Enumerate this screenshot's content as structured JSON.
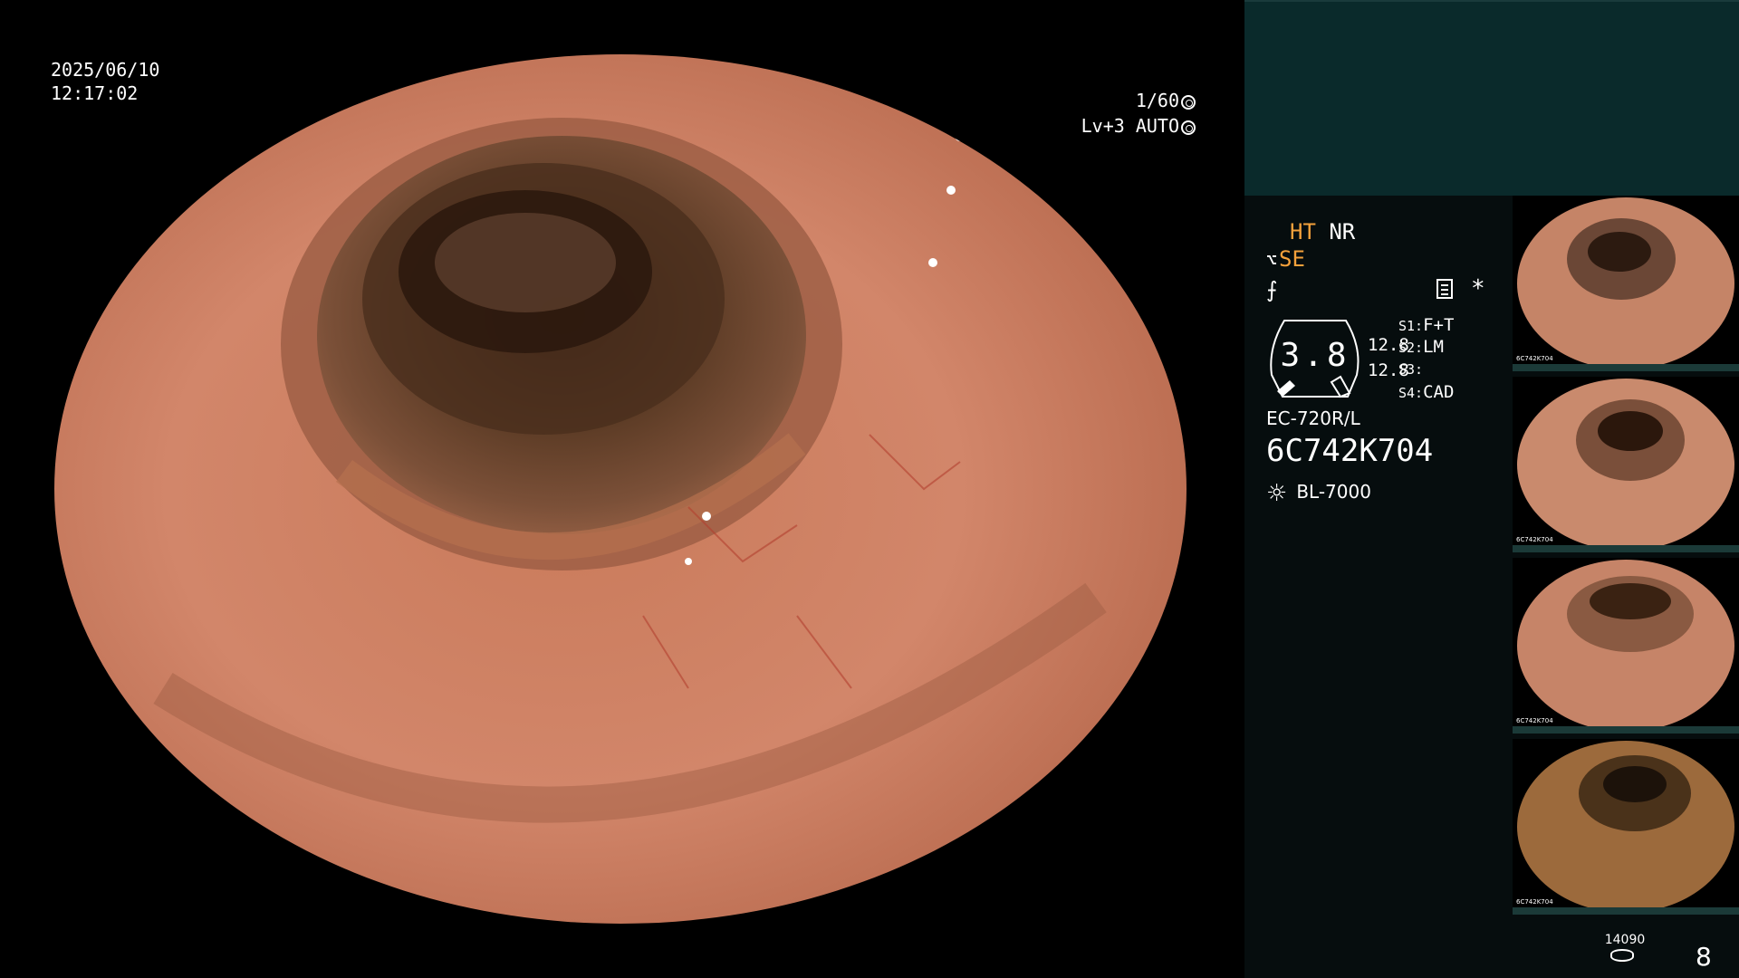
{
  "overlay": {
    "date": "2025/06/10",
    "time": "12:17:02",
    "shutter": "1/60",
    "brightness": "Lv+3 AUTO"
  },
  "status": {
    "ht": "HT",
    "nr": "NR",
    "se": "SE",
    "gauge_value": "3.8",
    "gauge_sub1": "12.8",
    "gauge_sub2": "12.8",
    "s1_key": "S1:",
    "s1_val": "F+T",
    "s2_key": "S2:",
    "s2_val": "LM",
    "s3_key": "S3:",
    "s3_val": "",
    "s4_key": "S4:",
    "s4_val": "CAD",
    "scope_model": "EC-720R/L",
    "scope_serial": "6C742K704",
    "light_source": "BL-7000"
  },
  "thumbnails": [
    {
      "caption": "6C742K704"
    },
    {
      "caption": "6C742K704"
    },
    {
      "caption": "6C742K704"
    },
    {
      "caption": "6C742K704"
    }
  ],
  "footer": {
    "frame_count": "14090",
    "page_number": "8"
  },
  "colors": {
    "accent_orange": "#f4a13b",
    "panel_bg": "#060d0e",
    "top_strip": "#0a2a2b"
  }
}
